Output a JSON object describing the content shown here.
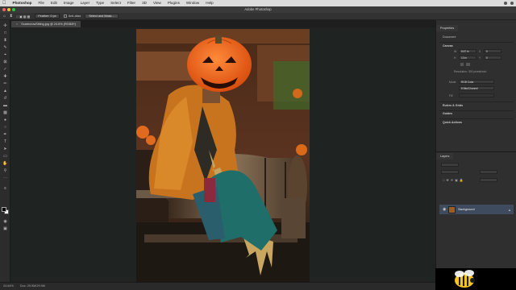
{
  "menubar": {
    "apple": "",
    "items": [
      "Photoshop",
      "File",
      "Edit",
      "Image",
      "Layer",
      "Type",
      "Select",
      "Filter",
      "3D",
      "View",
      "Plugins",
      "Window",
      "Help"
    ]
  },
  "window": {
    "title": "Adobe Photoshop"
  },
  "options": {
    "feather": "Feather: 0 px",
    "anti_alias": "Anti-alias",
    "select_mask": "Select and Mask..."
  },
  "document": {
    "tab_title": "ScarecrowSitting.jpg @ 24.6% (RGB/8*)"
  },
  "status": {
    "zoom": "24.64%",
    "doc_info": "Doc: 29.9M/29.9M"
  },
  "properties": {
    "tab": "Properties",
    "doc_label": "Document",
    "canvas_head": "Canvas",
    "w_label": "W",
    "w_value": "8.67 in",
    "h_label": "H",
    "h_value": "13 in",
    "x_label": "X",
    "x_value": "0",
    "y_label": "Y",
    "y_value": "0",
    "resolution": "Resolution: 300 pixels/inch",
    "mode_label": "Mode",
    "mode_value": "RGB Color",
    "depth_value": "8 Bits/Channel",
    "fill_label": "Fill",
    "rulers_head": "Rulers & Grids",
    "guides_head": "Guides",
    "quick_head": "Quick Actions"
  },
  "layers": {
    "tab": "Layers",
    "background_name": "Background"
  },
  "colors": {
    "accent": "#3e4a5e",
    "pumpkin": "#f26b1d",
    "coat": "#c8741e",
    "pants": "#1f6e6a"
  }
}
